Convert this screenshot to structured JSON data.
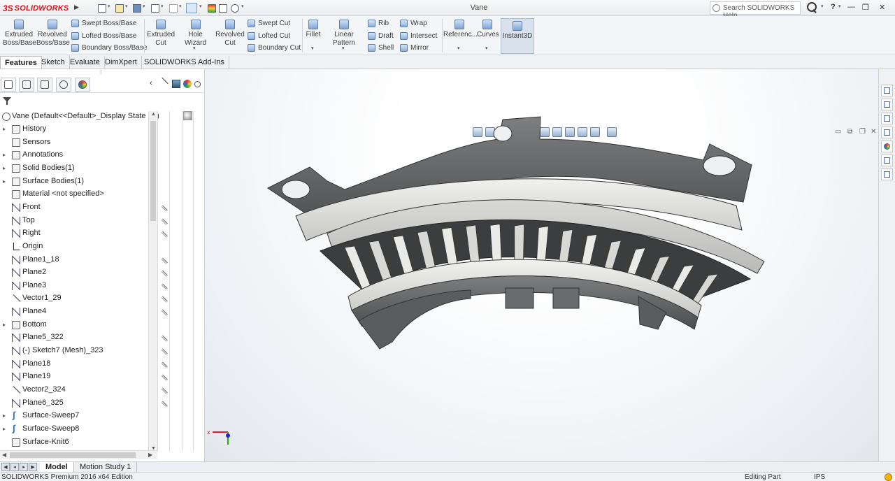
{
  "app": {
    "logo_ds": "3S",
    "logo_brand": "SOLIDWORKS",
    "doc_title": "Vane",
    "search_placeholder": "Search SOLIDWORKS Help",
    "help_label": "?",
    "minimize": "—",
    "restore": "❐",
    "close": "✕"
  },
  "ribbon": {
    "extruded_boss": "Extruded Boss/Base",
    "revolved_boss": "Revolved Boss/Base",
    "swept_boss": "Swept Boss/Base",
    "lofted_boss": "Lofted Boss/Base",
    "boundary_boss": "Boundary Boss/Base",
    "extruded_cut": "Extruded Cut",
    "hole_wizard": "Hole Wizard",
    "revolved_cut": "Revolved Cut",
    "swept_cut": "Swept Cut",
    "lofted_cut": "Lofted Cut",
    "boundary_cut": "Boundary Cut",
    "fillet": "Fillet",
    "linear_pattern": "Linear Pattern",
    "rib": "Rib",
    "draft": "Draft",
    "shell": "Shell",
    "wrap": "Wrap",
    "intersect": "Intersect",
    "mirror": "Mirror",
    "reference": "Referenc...",
    "curves": "Curves",
    "instant3d": "Instant3D"
  },
  "command_tabs": [
    "Features",
    "Sketch",
    "Evaluate",
    "DimXpert",
    "SOLIDWORKS Add-Ins"
  ],
  "tree": {
    "root": "Vane  (Default<<Default>_Display State 1>)",
    "items": [
      {
        "label": "History",
        "icon": "folder-icon",
        "arrow": true,
        "hidden_mark": false
      },
      {
        "label": "Sensors",
        "icon": "sensor-icon",
        "arrow": false,
        "hidden_mark": false
      },
      {
        "label": "Annotations",
        "icon": "annotation-icon",
        "arrow": true,
        "hidden_mark": false
      },
      {
        "label": "Solid Bodies(1)",
        "icon": "folder-icon",
        "arrow": true,
        "hidden_mark": false
      },
      {
        "label": "Surface Bodies(1)",
        "icon": "folder-icon",
        "arrow": true,
        "hidden_mark": false
      },
      {
        "label": "Material <not specified>",
        "icon": "material-icon",
        "arrow": false,
        "hidden_mark": false
      },
      {
        "label": "Front",
        "icon": "plane-icon",
        "arrow": false,
        "hidden_mark": true
      },
      {
        "label": "Top",
        "icon": "plane-icon",
        "arrow": false,
        "hidden_mark": true
      },
      {
        "label": "Right",
        "icon": "plane-icon",
        "arrow": false,
        "hidden_mark": true
      },
      {
        "label": "Origin",
        "icon": "origin-icon",
        "arrow": false,
        "hidden_mark": false
      },
      {
        "label": "Plane1_18",
        "icon": "plane-icon",
        "arrow": false,
        "hidden_mark": true
      },
      {
        "label": "Plane2",
        "icon": "plane-icon",
        "arrow": false,
        "hidden_mark": true
      },
      {
        "label": "Plane3",
        "icon": "plane-icon",
        "arrow": false,
        "hidden_mark": true
      },
      {
        "label": "Vector1_29",
        "icon": "vector-icon",
        "arrow": false,
        "hidden_mark": true
      },
      {
        "label": "Plane4",
        "icon": "plane-icon",
        "arrow": false,
        "hidden_mark": true
      },
      {
        "label": "Bottom",
        "icon": "folder-icon",
        "arrow": true,
        "hidden_mark": false
      },
      {
        "label": "Plane5_322",
        "icon": "plane-icon",
        "arrow": false,
        "hidden_mark": true
      },
      {
        "label": "(-) Sketch7 (Mesh)_323",
        "icon": "sketch-icon",
        "arrow": false,
        "hidden_mark": true
      },
      {
        "label": "Plane18",
        "icon": "plane-icon",
        "arrow": false,
        "hidden_mark": true
      },
      {
        "label": "Plane19",
        "icon": "plane-icon",
        "arrow": false,
        "hidden_mark": true
      },
      {
        "label": "Vector2_324",
        "icon": "vector-icon",
        "arrow": false,
        "hidden_mark": true
      },
      {
        "label": "Plane6_325",
        "icon": "plane-icon",
        "arrow": false,
        "hidden_mark": true
      },
      {
        "label": "Surface-Sweep7",
        "icon": "sweep-icon",
        "arrow": true,
        "hidden_mark": false
      },
      {
        "label": "Surface-Sweep8",
        "icon": "sweep-icon",
        "arrow": true,
        "hidden_mark": false
      },
      {
        "label": "Surface-Knit6",
        "icon": "knit-icon",
        "arrow": false,
        "hidden_mark": false
      }
    ]
  },
  "bottom_tabs": [
    "Model",
    "Motion Study 1"
  ],
  "status": {
    "edition": "SOLIDWORKS Premium 2016 x64 Edition",
    "mode": "Editing Part",
    "units": "IPS"
  },
  "colors": {
    "brand_red": "#d8141c",
    "part_gray": "#8a8b8d",
    "part_light": "#dcdcd8",
    "viewport_bg": "#eef1f5"
  }
}
